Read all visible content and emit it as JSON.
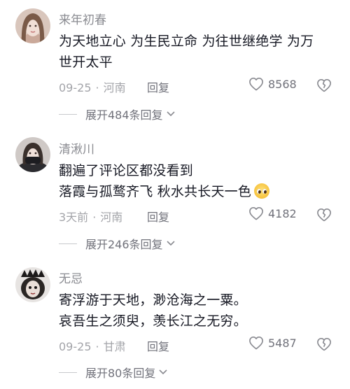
{
  "comments": [
    {
      "username": "来年初春",
      "lines": [
        "为天地立心 为生民立命 为往世继绝学 为万",
        "世开太平"
      ],
      "date": "09-25",
      "location": "河南",
      "reply_label": "回复",
      "likes": "8568",
      "expand_label": "展开484条回复",
      "avatar_icon": "avatar-portrait-light",
      "has_emoji": false
    },
    {
      "username": "清湫川",
      "lines": [
        "翻遍了评论区都没看到",
        "落霞与孤鹜齐飞 秋水共长天一色"
      ],
      "date": "3天前",
      "location": "河南",
      "reply_label": "回复",
      "likes": "4182",
      "expand_label": "展开246条回复",
      "avatar_icon": "avatar-portrait-masked",
      "has_emoji": true,
      "emoji_icon": "pleading-face-emoji"
    },
    {
      "username": "无忌",
      "lines": [
        "寄浮游于天地，渺沧海之一粟。",
        "哀吾生之须臾，羡长江之无穷。"
      ],
      "date": "09-25",
      "location": "甘肃",
      "reply_label": "回复",
      "likes": "5487",
      "expand_label": "展开80条回复",
      "avatar_icon": "avatar-portrait-dark",
      "has_emoji": false
    }
  ],
  "colors": {
    "text": "#161823",
    "username": "#8a8b91",
    "meta": "#a3a4a9",
    "action": "#70717a"
  }
}
